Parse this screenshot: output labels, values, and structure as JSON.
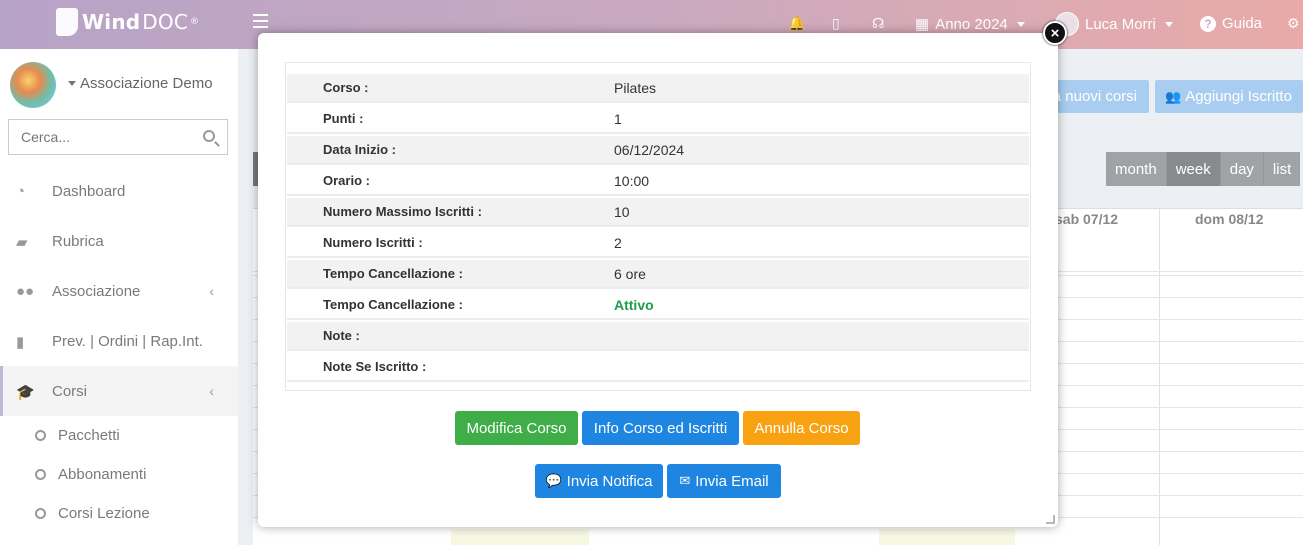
{
  "header": {
    "logo_text": "WindDOC",
    "logo_bold": "Wind",
    "logo_light": "DOC",
    "logo_reg": "®",
    "year_label": "Anno 2024",
    "user_name": "Luca Morri",
    "help_label": "Guida"
  },
  "sidebar": {
    "org_name": "Associazione Demo",
    "search_placeholder": "Cerca...",
    "items": [
      {
        "label": "Dashboard",
        "icon": "dashboard-icon"
      },
      {
        "label": "Rubrica",
        "icon": "book-icon"
      },
      {
        "label": "Associazione",
        "icon": "users-icon"
      },
      {
        "label": "Prev. | Ordini | Rap.Int.",
        "icon": "file-icon"
      },
      {
        "label": "Corsi",
        "icon": "graduation-cap-icon"
      }
    ],
    "sub_items": [
      "Pacchetti",
      "Abbonamenti",
      "Corsi Lezione"
    ]
  },
  "main": {
    "partial_button_label": "a nuovi corsi",
    "add_button_label": "Aggiungi Iscritto",
    "views": [
      "month",
      "week",
      "day",
      "list"
    ],
    "active_view": "week",
    "day_headers": [
      "sab 07/12",
      "dom 08/12"
    ]
  },
  "modal": {
    "rows": [
      {
        "key": "Corso :",
        "value": "Pilates"
      },
      {
        "key": "Punti :",
        "value": "1"
      },
      {
        "key": "Data Inizio :",
        "value": "06/12/2024"
      },
      {
        "key": "Orario :",
        "value": "10:00"
      },
      {
        "key": "Numero Massimo Iscritti :",
        "value": "10"
      },
      {
        "key": "Numero Iscritti :",
        "value": "2"
      },
      {
        "key": "Tempo Cancellazione :",
        "value": "6 ore"
      },
      {
        "key": "Tempo Cancellazione :",
        "value": "Attivo"
      },
      {
        "key": "Note :",
        "value": ""
      },
      {
        "key": "Note Se Iscritto :",
        "value": ""
      }
    ],
    "buttons": {
      "edit": "Modifica Corso",
      "info": "Info Corso ed Iscritti",
      "cancel": "Annulla Corso",
      "notify": "Invia Notifica",
      "email": "Invia Email"
    }
  },
  "colors": {
    "green": "#3fae49",
    "blue": "#1e86e0",
    "orange": "#f8a212",
    "active_green_text": "#1e9e48"
  }
}
